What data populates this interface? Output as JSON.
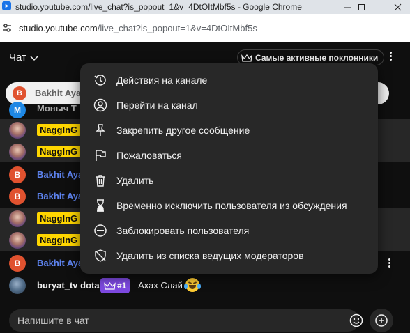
{
  "window": {
    "title": "studio.youtube.com/live_chat?is_popout=1&v=4DtOItMbf5s - Google Chrome"
  },
  "address_bar": {
    "host": "studio.youtube.com",
    "path": "/live_chat?is_popout=1&v=4DtOItMbf5s"
  },
  "chat_header": {
    "title": "Чат",
    "top_fans_label": "Самые активные поклонники"
  },
  "pinned": {
    "avatar_letter": "B",
    "author": "Bakhit Ayap"
  },
  "rows": [
    {
      "avatar_letter": "M",
      "author": "Моныч Т"
    },
    {
      "author": "NaggInG I"
    },
    {
      "author": "NaggInG I"
    },
    {
      "avatar_letter": "B",
      "author": "Bakhit Aya"
    },
    {
      "avatar_letter": "B",
      "author": "Bakhit Aya"
    },
    {
      "author": "NaggInG I"
    },
    {
      "author": "NaggInG I"
    },
    {
      "avatar_letter": "B",
      "author": "Bakhit Aya"
    },
    {
      "author": "buryat_tv dota",
      "badge": "#1",
      "message": "Ахах Слай"
    }
  ],
  "input": {
    "placeholder": "Напишите в чат"
  },
  "menu": {
    "items": [
      {
        "label": "Действия на канале",
        "icon": "history-icon"
      },
      {
        "label": "Перейти на канал",
        "icon": "account-icon"
      },
      {
        "label": "Закрепить другое сообщение",
        "icon": "pin-icon"
      },
      {
        "label": "Пожаловаться",
        "icon": "flag-icon"
      },
      {
        "label": "Удалить",
        "icon": "trash-icon"
      },
      {
        "label": "Временно исключить пользователя из обсуждения",
        "icon": "hourglass-icon"
      },
      {
        "label": "Заблокировать пользователя",
        "icon": "block-icon"
      },
      {
        "label": "Удалить из списка ведущих модераторов",
        "icon": "remove-moderator-icon"
      }
    ]
  },
  "colors": {
    "background": "#0f0f0f",
    "menu_background": "#282828",
    "author_blue": "#5e84f1",
    "owner_badge_yellow": "#ffd600",
    "member_badge_purple": "#7d49e0",
    "avatar_orange": "#e0522f"
  }
}
